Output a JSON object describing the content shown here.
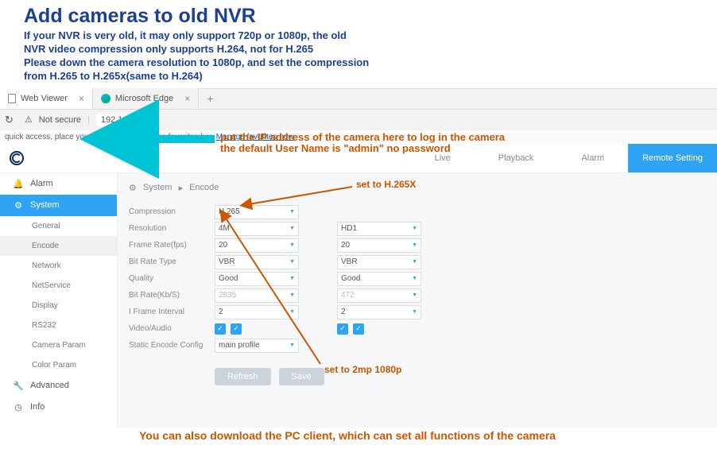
{
  "heading": "Add cameras to old NVR",
  "subtext": "If your NVR is very old, it may only support 720p or 1080p, the old\nNVR video compression only supports H.264, not for H.265\nPlease down the camera resolution to 1080p, and set the compression\nfrom H.265 to H.265x(same to H.264)",
  "browser": {
    "tab1": "Web Viewer",
    "tab2": "Microsoft Edge",
    "not_secure": "Not secure",
    "ip": "192.168.1.10",
    "fav_text": "quick access, place your favorites here on the favorites bar.",
    "fav_link": "Manage favorites now"
  },
  "orange_ip_note": "put the IP address of the camera here to  log in the camera\nthe default User Name is \"admin\" no password",
  "topnav": {
    "live": "Live",
    "playback": "Playback",
    "alarm": "Alarm",
    "remote": "Remote Setting"
  },
  "sidebar": {
    "alarm": "Alarm",
    "system": "System",
    "general": "General",
    "encode": "Encode",
    "network": "Network",
    "netservice": "NetService",
    "display": "Display",
    "rs232": "RS232",
    "camera_param": "Camera Param",
    "color_param": "Color Param",
    "advanced": "Advanced",
    "info": "Info"
  },
  "breadcrumb": {
    "a": "System",
    "b": "Encode"
  },
  "form": {
    "compression_label": "Compression",
    "compression": "H.265",
    "resolution_label": "Resolution",
    "resolution_a": "4M",
    "resolution_b": "HD1",
    "fps_label": "Frame Rate(fps)",
    "fps_a": "20",
    "fps_b": "20",
    "brtype_label": "Bit Rate Type",
    "brtype_a": "VBR",
    "brtype_b": "VBR",
    "quality_label": "Quality",
    "quality_a": "Good",
    "quality_b": "Good",
    "brkbs_label": "Bit Rate(Kb/S)",
    "brkbs_a": "2835",
    "brkbs_b": "472",
    "iframe_label": "I Frame Interval",
    "iframe_a": "2",
    "iframe_b": "2",
    "va_label": "Video/Audio",
    "static_label": "Static Encode Config",
    "static": "main profile"
  },
  "buttons": {
    "refresh": "Refresh",
    "save": "Save"
  },
  "annotations": {
    "h265x": "set to H.265X",
    "res1080": "set to 2mp 1080p",
    "download": "You can also download the PC client, which can set all functions of the camera"
  }
}
